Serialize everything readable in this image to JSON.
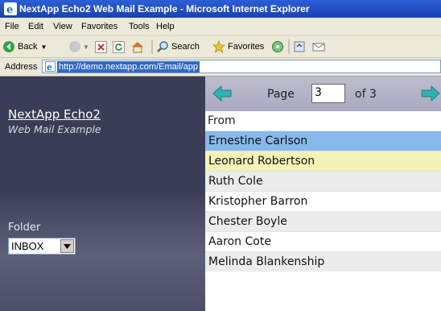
{
  "window": {
    "title": "NextApp Echo2 Web Mail Example - Microsoft Internet Explorer"
  },
  "menu": {
    "items": [
      "File",
      "Edit",
      "View",
      "Favorites",
      "Tools",
      "Help"
    ]
  },
  "toolbar": {
    "back_label": "Back",
    "search_label": "Search",
    "favorites_label": "Favorites"
  },
  "address": {
    "label": "Address",
    "url": "http://demo.nextapp.com/Email/app"
  },
  "app": {
    "name": "NextApp Echo2",
    "subtitle": "Web Mail Example"
  },
  "folder": {
    "label": "Folder",
    "selected": "INBOX"
  },
  "pager": {
    "page_label": "Page",
    "current_page": "3",
    "of_label": "of 3"
  },
  "messages": {
    "column_header": "From",
    "rows": [
      {
        "from": "Ernestine Carlson"
      },
      {
        "from": "Leonard Robertson"
      },
      {
        "from": "Ruth Cole"
      },
      {
        "from": "Kristopher Barron"
      },
      {
        "from": "Chester Boyle"
      },
      {
        "from": "Aaron Cote"
      },
      {
        "from": "Melinda Blankenship"
      }
    ]
  },
  "colors": {
    "sidebar": "#3a3d55",
    "selected_row": "#87b9ec",
    "highlight_row": "#f5f2b8",
    "alt_row": "#ececec",
    "pager_arrow": "#2fb3b3"
  }
}
